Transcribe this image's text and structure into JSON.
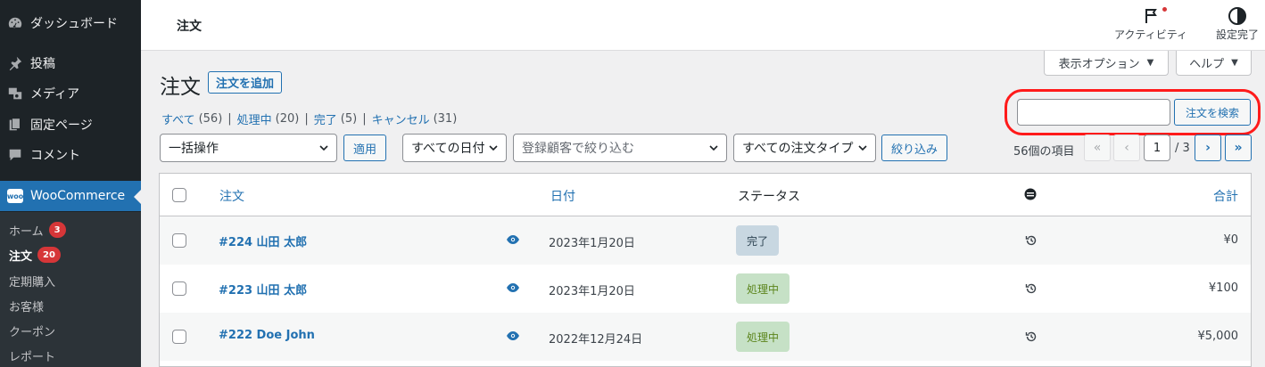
{
  "sidebar": {
    "items": [
      {
        "label": "ダッシュボード",
        "icon": "dashboard-icon"
      },
      {
        "label": "投稿",
        "icon": "pin-icon"
      },
      {
        "label": "メディア",
        "icon": "media-icon"
      },
      {
        "label": "固定ページ",
        "icon": "page-icon"
      },
      {
        "label": "コメント",
        "icon": "comment-icon"
      },
      {
        "label": "WooCommerce",
        "icon": "woo-icon",
        "logo_text": "woo"
      }
    ],
    "submenu": [
      {
        "label": "ホーム",
        "badge": "3"
      },
      {
        "label": "注文",
        "badge": "20"
      },
      {
        "label": "定期購入"
      },
      {
        "label": "お客様"
      },
      {
        "label": "クーポン"
      },
      {
        "label": "レポート"
      }
    ]
  },
  "header": {
    "title": "注文",
    "activity_label": "アクティビティ",
    "setup_label": "設定完了"
  },
  "screen_options": {
    "display_label": "表示オプション",
    "help_label": "ヘルプ"
  },
  "page": {
    "title": "注文",
    "add_button": "注文を追加"
  },
  "filters": {
    "views": [
      {
        "label": "すべて",
        "count": "(56)"
      },
      {
        "label": "処理中",
        "count": "(20)"
      },
      {
        "label": "完了",
        "count": "(5)"
      },
      {
        "label": "キャンセル",
        "count": "(31)"
      }
    ],
    "bulk_action": "一括操作",
    "apply_label": "適用",
    "date_filter": "すべての日付",
    "customer_placeholder": "登録顧客で絞り込む",
    "order_type": "すべての注文タイプ",
    "filter_button": "絞り込み"
  },
  "search": {
    "value": "",
    "button": "注文を検索"
  },
  "pagination": {
    "items_label": "56個の項目",
    "first": "«",
    "prev": "‹",
    "current_page": "1",
    "total_pages": "/ 3",
    "next": "›",
    "last": "»"
  },
  "table": {
    "columns": {
      "order": "注文",
      "date": "日付",
      "status": "ステータス",
      "total": "合計"
    },
    "rows": [
      {
        "order": "#224 山田 太郎",
        "date": "2023年1月20日",
        "status": "完了",
        "status_color": "#c8d7e1",
        "status_text_color": "#2e4453",
        "total": "¥0"
      },
      {
        "order": "#223 山田 太郎",
        "date": "2023年1月20日",
        "status": "処理中",
        "status_color": "#c6e1c6",
        "status_text_color": "#5b841b",
        "total": "¥100"
      },
      {
        "order": "#222 Doe John",
        "date": "2022年12月24日",
        "status": "処理中",
        "status_color": "#c6e1c6",
        "status_text_color": "#5b841b",
        "total": "¥5,000"
      }
    ]
  },
  "colors": {
    "accent": "#2271b1",
    "sidebar_bg": "#1d2327",
    "highlight": "#ff1a1a",
    "badge": "#d63638"
  }
}
